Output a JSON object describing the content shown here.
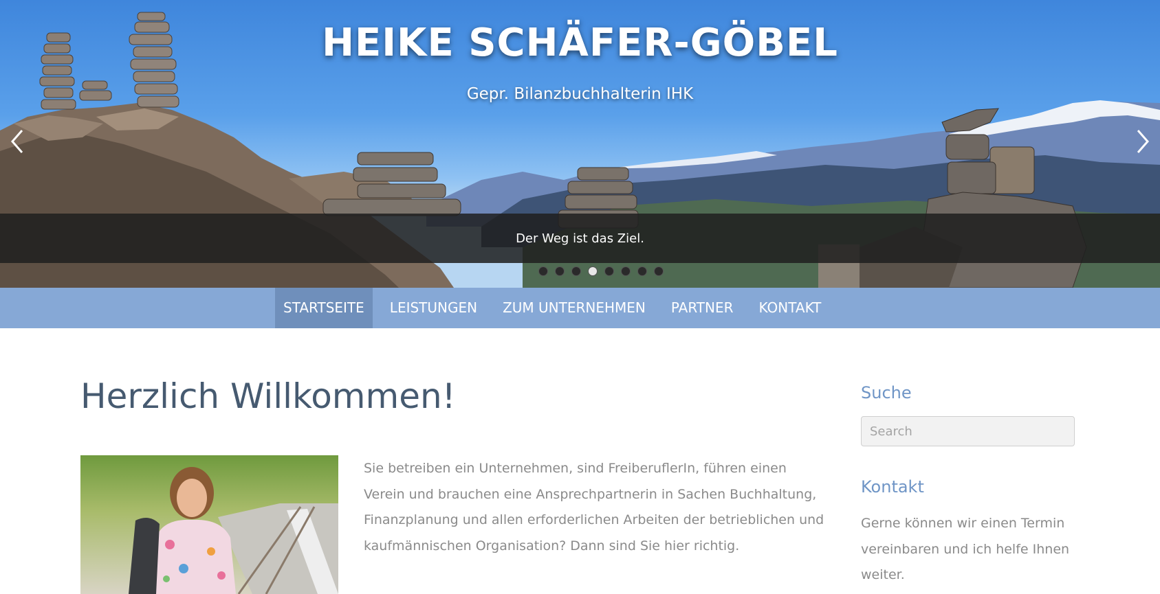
{
  "hero": {
    "title": "HEIKE SCHÄFER-GÖBEL",
    "subtitle": "Gepr. Bilanzbuchhalterin IHK",
    "caption": "Der Weg ist das Ziel.",
    "prev_icon": "chevron-left-icon",
    "next_icon": "chevron-right-icon",
    "slide_count": 8,
    "active_slide": 3
  },
  "nav": {
    "items": [
      {
        "label": "STARTSEITE",
        "active": true
      },
      {
        "label": "LEISTUNGEN",
        "active": false
      },
      {
        "label": "ZUM UNTERNEHMEN",
        "active": false
      },
      {
        "label": "PARTNER",
        "active": false
      },
      {
        "label": "KONTAKT",
        "active": false
      }
    ]
  },
  "main": {
    "title": "Herzlich Willkommen!",
    "intro": "Sie betreiben ein Unternehmen, sind FreiberuflerIn, führen einen Verein  und brauchen eine Ansprechpartnerin in Sachen Buchhaltung, Finanzplanung und allen erforderlichen Arbeiten der betrieblichen und kaufmännischen Organisation? Dann sind Sie hier richtig."
  },
  "sidebar": {
    "search_heading": "Suche",
    "search_placeholder": "Search",
    "contact_heading": "Kontakt",
    "contact_text": "Gerne können wir einen Termin vereinbaren und ich helfe Ihnen weiter."
  },
  "colors": {
    "nav_bg": "#86a8d6",
    "nav_active": "#6f8fbb",
    "heading": "#465a70",
    "sidebar_heading": "#6f95c6",
    "body_text": "#8a8a8a"
  }
}
